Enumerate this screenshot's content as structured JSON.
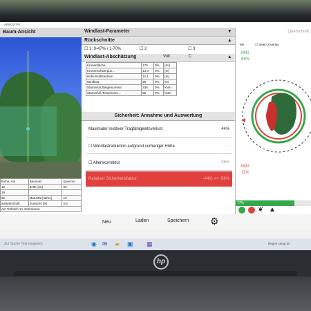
{
  "window": {
    "title": "ARBOSTAT"
  },
  "left_panel": {
    "title": "Baum-Ansicht",
    "details": [
      [
        "Eiche, Am.",
        "Baumart:",
        "Quercus"
      ],
      [
        "19",
        "BHD [cm]",
        "90"
      ],
      [
        "19",
        "",
        ""
      ],
      [
        "65",
        "Maturität [Jahre]",
        "15"
      ],
      [
        "andwirtschaft",
        "Zuwachs [%]",
        "0,5"
      ],
      [
        "",
        "Am Torfstich 14, Edemissen",
        ""
      ]
    ]
  },
  "middle_panel": {
    "windlast_header": "Windlast-Parameter",
    "rueckschnitte_header": "Rückschnitte",
    "rueckschnitt_options": [
      "1: 0-47% / 1-70%",
      "2",
      "3"
    ],
    "abschaetzung": {
      "header": "Windlast-Abschätzung",
      "col1": "Voll",
      "col2": "C",
      "rows": [
        [
          "Kronenfläche",
          "170",
          "0%",
          "[m²]"
        ],
        [
          "Kronenschwerpun...",
          "13,4",
          "0%",
          "[m]"
        ],
        [
          "Höhe Kraftzentrum",
          "12,1",
          "0%",
          "[m]"
        ],
        [
          "Windlast",
          "28",
          "0%",
          "kN"
        ],
        [
          "Stammfuß Biegemoment",
          "338",
          "0%",
          "kNm"
        ],
        [
          "Stammfuß Torsionsmo...",
          "55",
          "0%",
          "kNm"
        ]
      ]
    },
    "sicherheit_header": "Sicherheit: Annahme und Auswertung",
    "max_verlust_label": "Maximaler relativer Tragfähigkeitsverlust",
    "max_verlust_value": "44%",
    "windlastreduktion_label": "Windlastreduktion aufgrund vorheriger Höhe",
    "windlastreduktion_value": "...",
    "alterskorrektur_label": "Alterskorrektur",
    "alterskorrektur_value": "26%",
    "result_label": "Relativer Sicherheitsfaktor",
    "result_value": "-44% >> -58%"
  },
  "buttons": {
    "new": "Neu",
    "load": "Laden",
    "save": "Speichern"
  },
  "right_panel": {
    "title": "Querschnitt",
    "opt_label": "Me",
    "overlay_label": "Select Overlay",
    "min_top_label": "MIN",
    "min_top_value": "68%",
    "min_bottom_label": "MIN",
    "min_bottom_value": "11%",
    "progress_value": "77%",
    "progress_fraction": 0.77
  },
  "taskbar": {
    "search_placeholder": "Zur Suche Text eingeben",
    "weather": "Regen steigt an"
  },
  "colors": {
    "danger": "#e0413e",
    "good": "#35a84a",
    "accent": "#3b6fb6"
  }
}
